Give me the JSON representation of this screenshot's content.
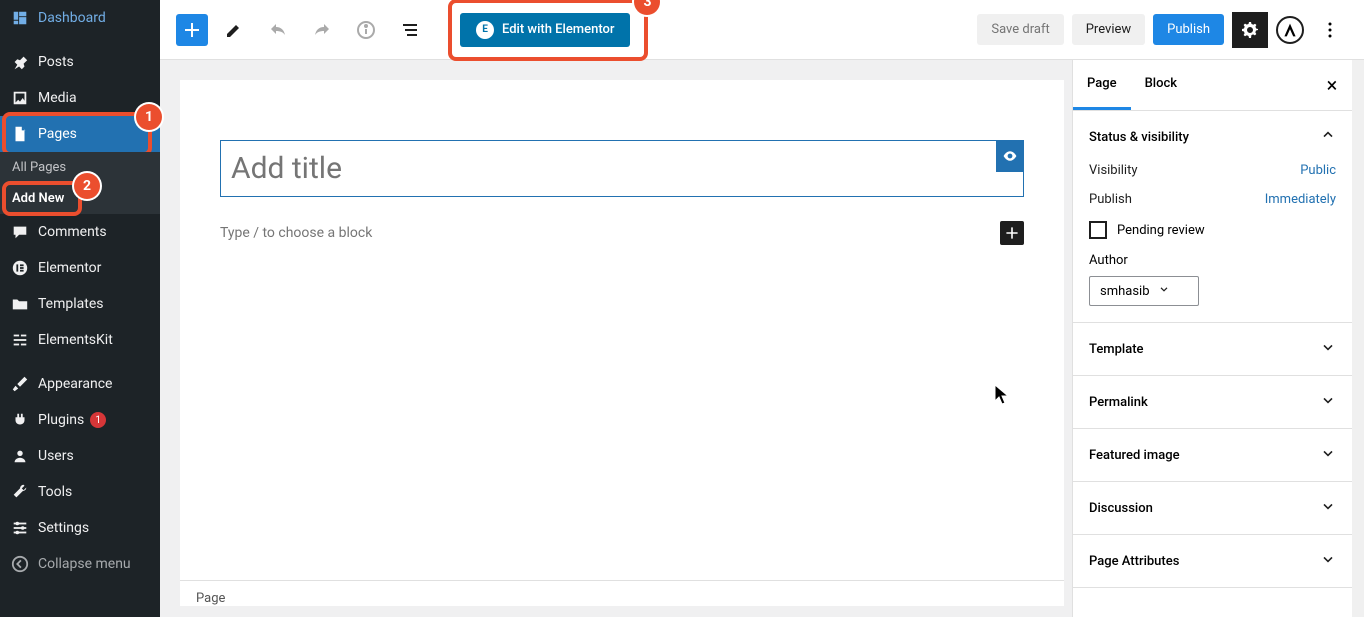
{
  "sidebar": {
    "dashboard": "Dashboard",
    "posts": "Posts",
    "media": "Media",
    "pages": "Pages",
    "all_pages": "All Pages",
    "add_new": "Add New",
    "comments": "Comments",
    "elementor": "Elementor",
    "templates": "Templates",
    "elementskit": "ElementsKit",
    "appearance": "Appearance",
    "plugins": "Plugins",
    "plugins_badge": "1",
    "users": "Users",
    "tools": "Tools",
    "settings": "Settings",
    "collapse": "Collapse menu"
  },
  "toolbar": {
    "elementor_label": "Edit with Elementor",
    "save_draft": "Save draft",
    "preview": "Preview",
    "publish": "Publish"
  },
  "editor": {
    "title_placeholder": "Add title",
    "block_placeholder": "Type / to choose a block",
    "footer_tab": "Page"
  },
  "panel": {
    "tab_page": "Page",
    "tab_block": "Block",
    "status_header": "Status & visibility",
    "visibility_label": "Visibility",
    "visibility_value": "Public",
    "publish_label": "Publish",
    "publish_value": "Immediately",
    "pending_review": "Pending review",
    "author_label": "Author",
    "author_value": "smhasib",
    "template": "Template",
    "permalink": "Permalink",
    "featured_image": "Featured image",
    "discussion": "Discussion",
    "page_attributes": "Page Attributes"
  },
  "annotations": {
    "badge1": "1",
    "badge2": "2",
    "badge3": "3"
  }
}
